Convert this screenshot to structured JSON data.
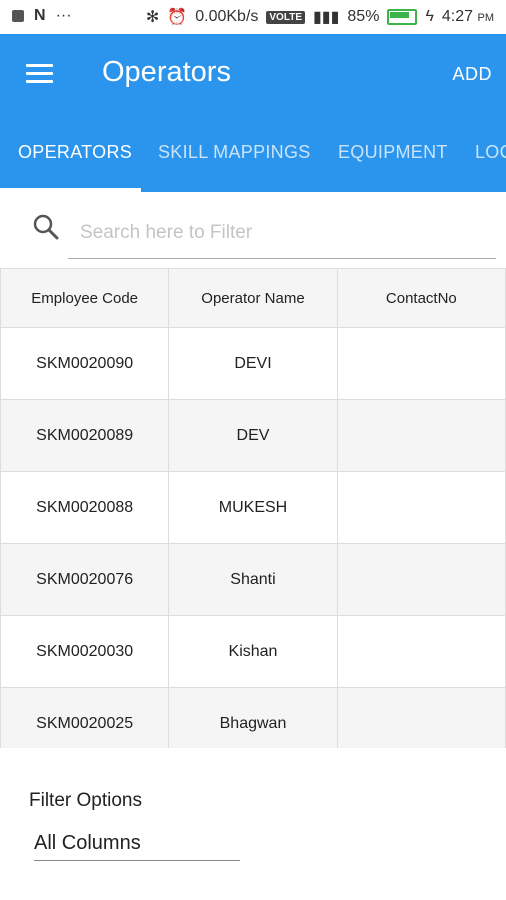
{
  "status_bar": {
    "data_speed": "0.00Kb/s",
    "volte": "VOLTE",
    "battery": "85%",
    "time": "4:27",
    "ampm": "PM"
  },
  "header": {
    "title": "Operators",
    "add_label": "ADD",
    "color": "#2b95ee"
  },
  "tabs": [
    {
      "label": "OPERATORS",
      "active": true
    },
    {
      "label": "SKILL MAPPINGS",
      "active": false
    },
    {
      "label": "EQUIPMENT",
      "active": false
    },
    {
      "label": "LOC",
      "active": false
    }
  ],
  "search": {
    "placeholder": "Search here to Filter",
    "value": ""
  },
  "table": {
    "columns": [
      "Employee Code",
      "Operator Name",
      "ContactNo"
    ],
    "rows": [
      {
        "code": "SKM0020090",
        "name": "DEVI",
        "contact": ""
      },
      {
        "code": "SKM0020089",
        "name": "DEV",
        "contact": ""
      },
      {
        "code": "SKM0020088",
        "name": "MUKESH",
        "contact": ""
      },
      {
        "code": "SKM0020076",
        "name": "Shanti",
        "contact": ""
      },
      {
        "code": "SKM0020030",
        "name": "Kishan",
        "contact": ""
      },
      {
        "code": "SKM0020025",
        "name": "Bhagwan",
        "contact": ""
      }
    ]
  },
  "filter": {
    "label": "Filter Options",
    "selected": "All Columns"
  }
}
